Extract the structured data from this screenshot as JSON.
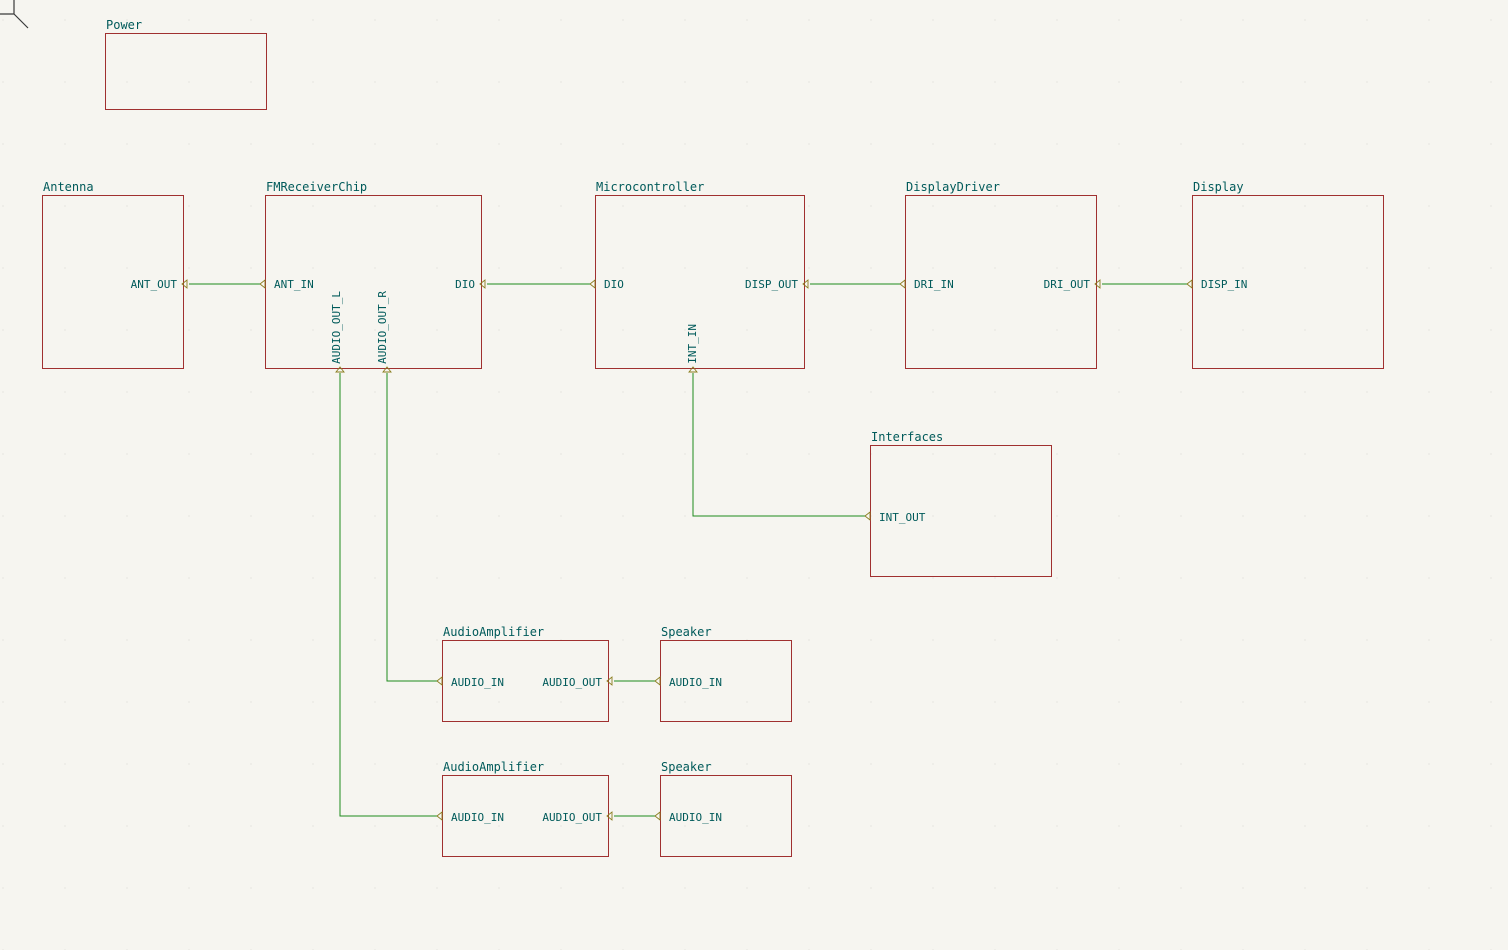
{
  "blocks": {
    "power": {
      "title": "Power"
    },
    "antenna": {
      "title": "Antenna",
      "ports": {
        "ant_out": "ANT_OUT"
      }
    },
    "fm": {
      "title": "FMReceiverChip",
      "ports": {
        "ant_in": "ANT_IN",
        "dio": "DIO",
        "audio_l": "AUDIO_OUT_L",
        "audio_r": "AUDIO_OUT_R"
      }
    },
    "mcu": {
      "title": "Microcontroller",
      "ports": {
        "dio": "DIO",
        "disp_out": "DISP_OUT",
        "int_in": "INT_IN"
      }
    },
    "dispdrv": {
      "title": "DisplayDriver",
      "ports": {
        "dri_in": "DRI_IN",
        "dri_out": "DRI_OUT"
      }
    },
    "display": {
      "title": "Display",
      "ports": {
        "disp_in": "DISP_IN"
      }
    },
    "interfaces": {
      "title": "Interfaces",
      "ports": {
        "int_out": "INT_OUT"
      }
    },
    "amp1": {
      "title": "AudioAmplifier",
      "ports": {
        "audio_in": "AUDIO_IN",
        "audio_out": "AUDIO_OUT"
      }
    },
    "spk1": {
      "title": "Speaker",
      "ports": {
        "audio_in": "AUDIO_IN"
      }
    },
    "amp2": {
      "title": "AudioAmplifier",
      "ports": {
        "audio_in": "AUDIO_IN",
        "audio_out": "AUDIO_OUT"
      }
    },
    "spk2": {
      "title": "Speaker",
      "ports": {
        "audio_in": "AUDIO_IN"
      }
    }
  }
}
